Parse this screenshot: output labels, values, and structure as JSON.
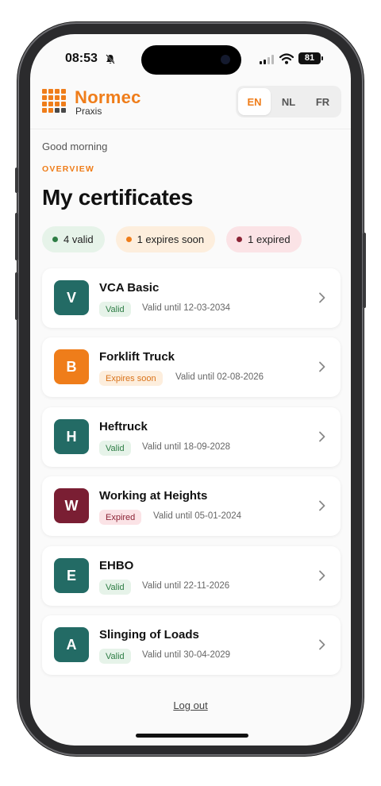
{
  "status_bar": {
    "time": "08:53",
    "battery": "81"
  },
  "brand": {
    "name": "Normec",
    "sub": "Praxis",
    "accent": "#ef7d1a"
  },
  "languages": [
    {
      "label": "EN",
      "active": true
    },
    {
      "label": "NL",
      "active": false
    },
    {
      "label": "FR",
      "active": false
    }
  ],
  "greeting": "Good morning",
  "overline": "OVERVIEW",
  "title": "My certificates",
  "summary": [
    {
      "label": "4 valid",
      "status": "valid"
    },
    {
      "label": "1 expires soon",
      "status": "soon"
    },
    {
      "label": "1 expired",
      "status": "expired"
    }
  ],
  "certificates": [
    {
      "initial": "V",
      "name": "VCA Basic",
      "status": "Valid",
      "state": "valid",
      "valid_until": "Valid until 12-03-2034"
    },
    {
      "initial": "B",
      "name": "Forklift Truck",
      "status": "Expires soon",
      "state": "soon",
      "valid_until": "Valid until 02-08-2026"
    },
    {
      "initial": "H",
      "name": "Heftruck",
      "status": "Valid",
      "state": "valid",
      "valid_until": "Valid until 18-09-2028"
    },
    {
      "initial": "W",
      "name": "Working at Heights",
      "status": "Expired",
      "state": "expired",
      "valid_until": "Valid until 05-01-2024"
    },
    {
      "initial": "E",
      "name": "EHBO",
      "status": "Valid",
      "state": "valid",
      "valid_until": "Valid until 22-11-2026"
    },
    {
      "initial": "A",
      "name": "Slinging of Loads",
      "status": "Valid",
      "state": "valid",
      "valid_until": "Valid until 30-04-2029"
    }
  ],
  "logout": "Log out",
  "colors": {
    "valid": "#236b65",
    "soon": "#ef7d1a",
    "expired": "#7a1e33",
    "valid_bg": "#e6f3e9",
    "valid_text": "#2e7d45",
    "valid_dot": "#2e7d45",
    "soon_bg": "#fdeedd",
    "soon_text": "#d9731a",
    "soon_dot": "#ef7d1a",
    "expired_bg": "#fbe3e6",
    "expired_text": "#8b2335",
    "expired_dot": "#8b2335"
  }
}
